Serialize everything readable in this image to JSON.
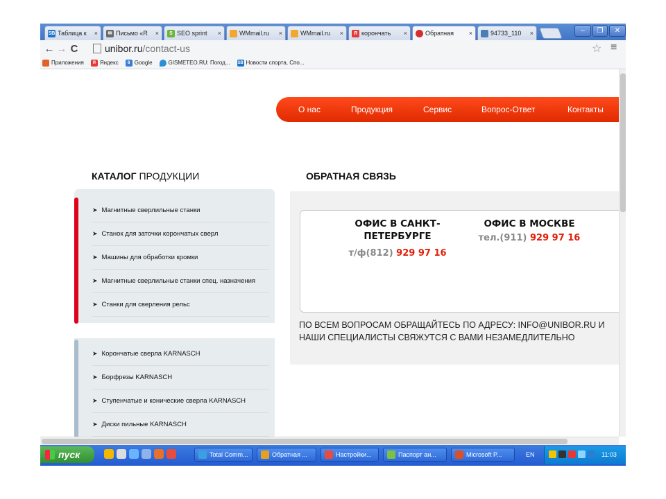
{
  "browser": {
    "tabs": [
      {
        "label": "Таблица к",
        "fav": "sports-favicon",
        "color": "#1f73c9",
        "active": false
      },
      {
        "label": "Письмо «R",
        "fav": "mail-favicon",
        "color": "#6a6a6a",
        "active": false
      },
      {
        "label": "SEO sprint",
        "fav": "seo-favicon",
        "color": "#6ab43a",
        "active": false
      },
      {
        "label": "WMmail.ru",
        "fav": "wmmail-favicon",
        "color": "#f0a830",
        "active": false
      },
      {
        "label": "WMmail.ru",
        "fav": "wmmail-favicon",
        "color": "#f0a830",
        "active": false
      },
      {
        "label": "корончать",
        "fav": "yandex-favicon",
        "color": "#e53935",
        "active": false
      },
      {
        "label": "Обратная",
        "fav": "unibor-favicon",
        "color": "#d32f2f",
        "active": true
      },
      {
        "label": "94733_110",
        "fav": "image-favicon",
        "color": "#4a7fb5",
        "active": false
      }
    ],
    "url_host": "unibor.ru",
    "url_path": "/contact-us",
    "bookmarks": [
      {
        "label": "Приложения",
        "color": "#e0602a"
      },
      {
        "label": "Яндекс",
        "color": "#e53935"
      },
      {
        "label": "Google",
        "color": "#3a7bd5"
      },
      {
        "label": "GISMETEO.RU: Погод...",
        "color": "#2b8fd6"
      },
      {
        "label": "Новости спорта, Спо...",
        "color": "#1f73c9"
      }
    ]
  },
  "site": {
    "nav": [
      "О нас",
      "Продукция",
      "Сервис",
      "Вопрос-Ответ",
      "Контакты"
    ],
    "catalog_title_bold": "КАТАЛОГ",
    "catalog_title_rest": "ПРОДУКЦИИ",
    "catalog_group1": [
      "Магнитные сверлильные станки",
      "Станок для заточки корончатых сверл",
      "Машины для обработки кромки",
      "Магнитные сверлильные станки спец. назначения",
      "Станки для сверления рельс"
    ],
    "catalog_group2": [
      "Корончатые сверла KARNASCH",
      "Борфрезы KARNASCH",
      "Ступенчатые и конические сверла KARNASCH",
      "Диски пильные KARNASCH"
    ],
    "feedback_title": "ОБРАТНАЯ СВЯЗЬ",
    "offices": [
      {
        "name_line1": "ОФИС В САНКТ-",
        "name_line2": "ПЕТЕРБУРГЕ",
        "phone_prefix": "т/ф(812) ",
        "phone_number": "929 97 16"
      },
      {
        "name_line1": "ОФИС В МОСКВЕ",
        "name_line2": "",
        "phone_prefix": "тел.(911) ",
        "phone_number": "929 97 16"
      }
    ],
    "note": "ПО ВСЕМ ВОПРОСАМ ОБРАЩАЙТЕСЬ ПО АДРЕСУ: INFO@UNIBOR.RU И НАШИ СПЕЦИАЛИСТЫ СВЯЖУТСЯ С ВАМИ НЕЗАМЕДЛИТЕЛЬНО"
  },
  "taskbar": {
    "start_label": "пуск",
    "tasks": [
      {
        "label": "Total Comm...",
        "color": "#3aa0e0"
      },
      {
        "label": "Обратная ...",
        "color": "#e8a020"
      },
      {
        "label": "Настройки...",
        "color": "#e74c3c"
      },
      {
        "label": "Паспорт ан...",
        "color": "#7cc242"
      },
      {
        "label": "Microsoft P...",
        "color": "#d9502a"
      }
    ],
    "lang": "EN",
    "clock": "11:03"
  }
}
